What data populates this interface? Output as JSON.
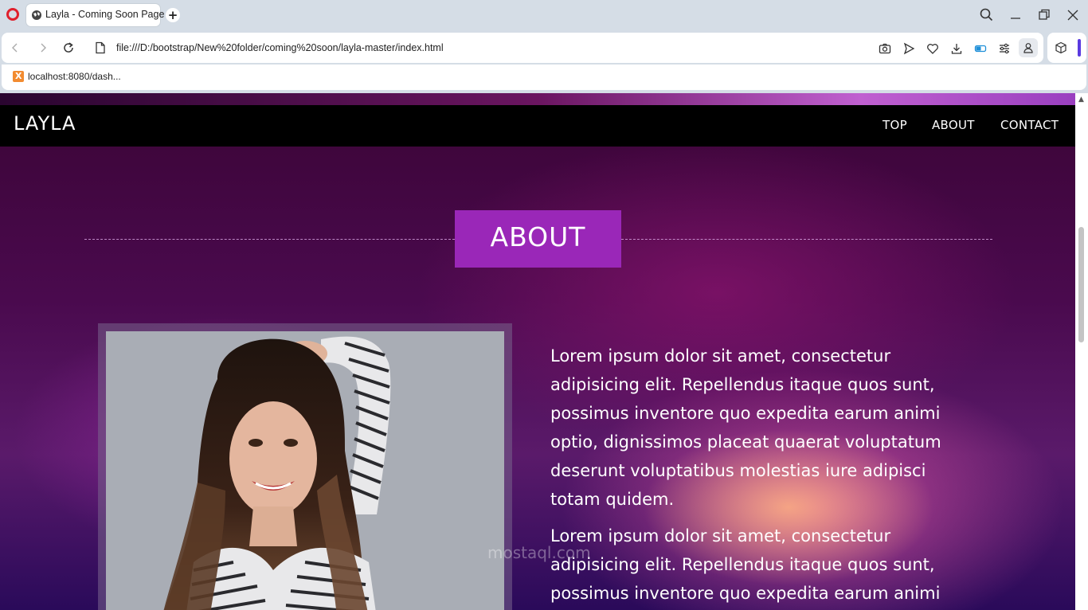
{
  "browser": {
    "tab_title": "Layla - Coming Soon Page",
    "url": "file:///D:/bootstrap/New%20folder/coming%20soon/layla-master/index.html",
    "bookmark": "localhost:8080/dash..."
  },
  "page": {
    "brand": "LAYLA",
    "nav": [
      "TOP",
      "ABOUT",
      "CONTACT"
    ],
    "section_title": "ABOUT",
    "paragraphs": [
      "Lorem ipsum dolor sit amet, consectetur adipisicing elit. Repellendus itaque quos sunt, possimus inventore quo expedita earum animi optio, dignissimos placeat quaerat voluptatum deserunt voluptatibus molestias iure adipisci totam quidem.",
      "Lorem ipsum dolor sit amet, consectetur adipisicing elit. Repellendus itaque quos sunt, possimus inventore quo expedita earum animi"
    ],
    "watermark": "mostaql.com"
  },
  "colors": {
    "accent": "#9a27b8",
    "navbar": "#000000"
  }
}
